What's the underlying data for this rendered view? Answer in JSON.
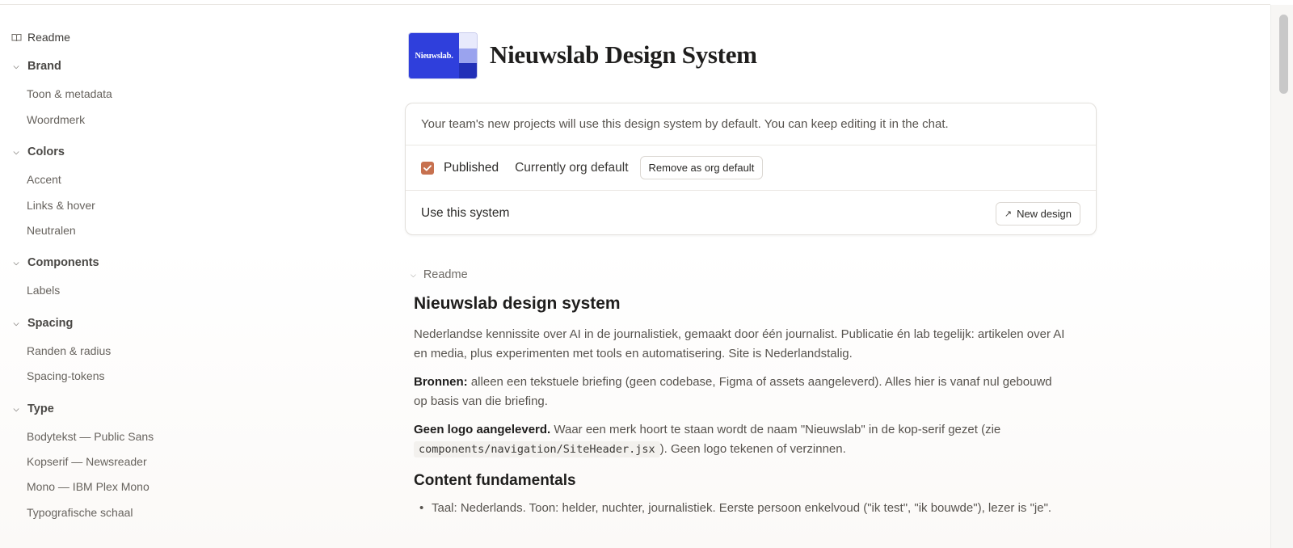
{
  "sidebar": {
    "readme_label": "Readme",
    "sections": [
      {
        "title": "Brand",
        "items": [
          "Toon & metadata",
          "Woordmerk"
        ]
      },
      {
        "title": "Colors",
        "items": [
          "Accent",
          "Links & hover",
          "Neutralen"
        ]
      },
      {
        "title": "Components",
        "items": [
          "Labels"
        ]
      },
      {
        "title": "Spacing",
        "items": [
          "Randen & radius",
          "Spacing-tokens"
        ]
      },
      {
        "title": "Type",
        "items": [
          "Bodytekst — Public Sans",
          "Kopserif — Newsreader",
          "Mono — IBM Plex Mono",
          "Typografische schaal"
        ]
      }
    ]
  },
  "header": {
    "logo_text": "Nieuwslab.",
    "title": "Nieuwslab Design System"
  },
  "card": {
    "info": "Your team's new projects will use this design system by default. You can keep editing it in the chat.",
    "published_label": "Published",
    "published_checked": true,
    "org_default_label": "Currently org default",
    "remove_default_button": "Remove as org default",
    "use_label": "Use this system",
    "new_design_button": "New design"
  },
  "readme": {
    "toggle_label": "Readme",
    "heading": "Nieuwslab design system",
    "intro": "Nederlandse kennissite over AI in de journalistiek, gemaakt door één journalist. Publicatie én lab tegelijk: artikelen over AI en media, plus experimenten met tools en automatisering. Site is Nederlandstalig.",
    "sources_bold": "Bronnen:",
    "sources_text": " alleen een tekstuele briefing (geen codebase, Figma of assets aangeleverd). Alles hier is vanaf nul gebouwd op basis van die briefing.",
    "logo_bold": "Geen logo aangeleverd.",
    "logo_text": " Waar een merk hoort te staan wordt de naam \"Nieuwslab\" in de kop-serif gezet (zie ",
    "logo_code": "components/navigation/SiteHeader.jsx",
    "logo_tail": "). Geen logo tekenen of verzinnen.",
    "content_heading": "Content fundamentals",
    "bullet_1": "Taal: Nederlands. Toon: helder, nuchter, journalistiek. Eerste persoon enkelvoud (\"ik test\", \"ik bouwde\"), lezer is \"je\"."
  },
  "colors": {
    "brand_blue": "#2f3fdc",
    "logo_strip": [
      "#e8eafc",
      "#9aa3ee",
      "#2230b8"
    ],
    "checkbox": "#c7714f"
  }
}
